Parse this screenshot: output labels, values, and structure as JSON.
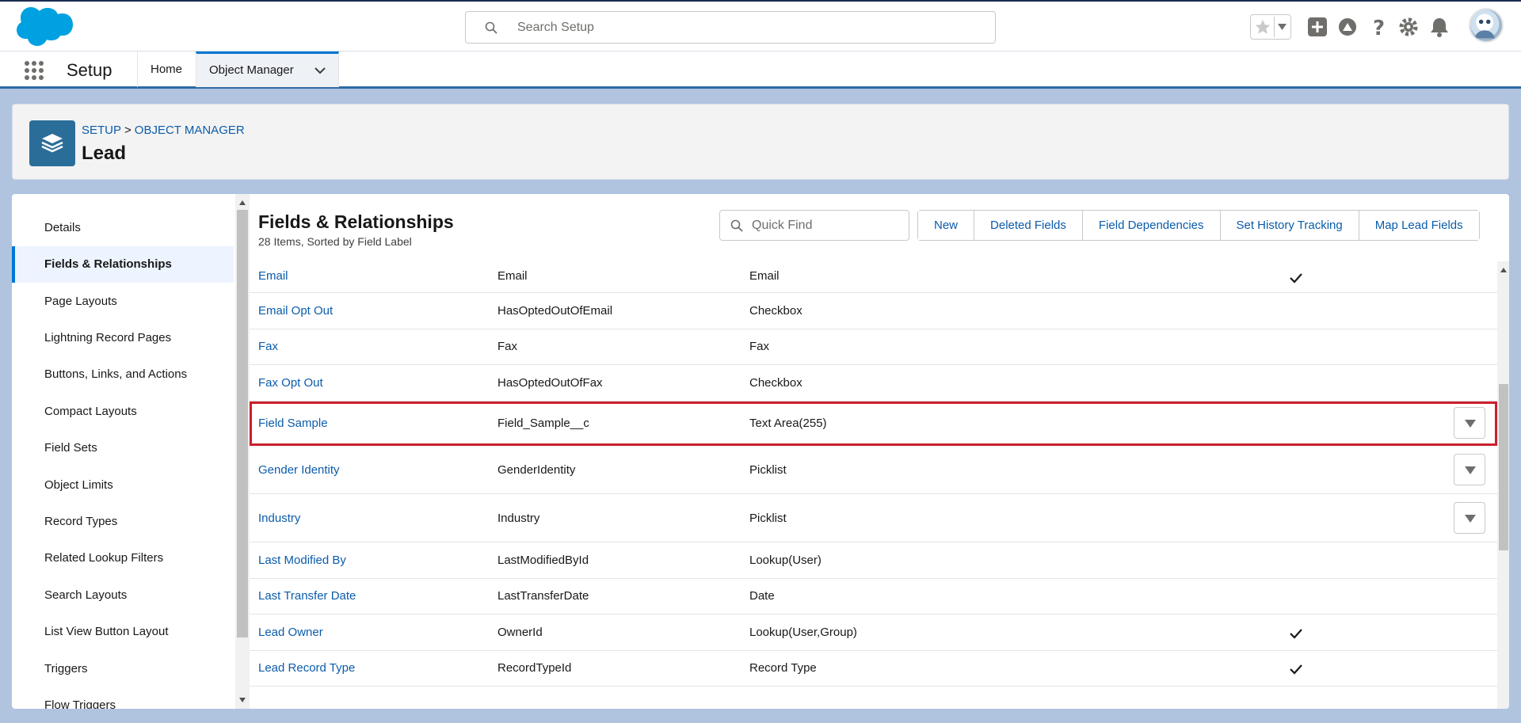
{
  "header": {
    "search_placeholder": "Search Setup",
    "icons": [
      "favorites-star-icon",
      "add-icon",
      "trailhead-icon",
      "help-icon",
      "gear-icon",
      "bell-icon",
      "avatar"
    ]
  },
  "nav": {
    "app_title": "Setup",
    "tabs": [
      {
        "label": "Home"
      },
      {
        "label": "Object Manager",
        "active": true
      }
    ]
  },
  "page_header": {
    "breadcrumb": [
      "SETUP",
      ">",
      "OBJECT MANAGER"
    ],
    "object_name": "Lead"
  },
  "sidebar": {
    "items": [
      {
        "label": "Details"
      },
      {
        "label": "Fields & Relationships",
        "active": true
      },
      {
        "label": "Page Layouts"
      },
      {
        "label": "Lightning Record Pages"
      },
      {
        "label": "Buttons, Links, and Actions"
      },
      {
        "label": "Compact Layouts"
      },
      {
        "label": "Field Sets"
      },
      {
        "label": "Object Limits"
      },
      {
        "label": "Record Types"
      },
      {
        "label": "Related Lookup Filters"
      },
      {
        "label": "Search Layouts"
      },
      {
        "label": "List View Button Layout"
      },
      {
        "label": "Triggers"
      },
      {
        "label": "Flow Triggers"
      }
    ]
  },
  "section": {
    "title": "Fields & Relationships",
    "subtitle": "28 Items, Sorted by Field Label",
    "quick_find_placeholder": "Quick Find",
    "buttons": [
      "New",
      "Deleted Fields",
      "Field Dependencies",
      "Set History Tracking",
      "Map Lead Fields"
    ]
  },
  "fields": [
    {
      "label": "Email",
      "api": "Email",
      "type": "Email",
      "indexed": true,
      "menu": false
    },
    {
      "label": "Email Opt Out",
      "api": "HasOptedOutOfEmail",
      "type": "Checkbox",
      "indexed": false,
      "menu": false
    },
    {
      "label": "Fax",
      "api": "Fax",
      "type": "Fax",
      "indexed": false,
      "menu": false
    },
    {
      "label": "Fax Opt Out",
      "api": "HasOptedOutOfFax",
      "type": "Checkbox",
      "indexed": false,
      "menu": false
    },
    {
      "label": "Field Sample",
      "api": "Field_Sample__c",
      "type": "Text Area(255)",
      "indexed": false,
      "menu": true,
      "highlighted": true
    },
    {
      "label": "Gender Identity",
      "api": "GenderIdentity",
      "type": "Picklist",
      "indexed": false,
      "menu": true
    },
    {
      "label": "Industry",
      "api": "Industry",
      "type": "Picklist",
      "indexed": false,
      "menu": true
    },
    {
      "label": "Last Modified By",
      "api": "LastModifiedById",
      "type": "Lookup(User)",
      "indexed": false,
      "menu": false
    },
    {
      "label": "Last Transfer Date",
      "api": "LastTransferDate",
      "type": "Date",
      "indexed": false,
      "menu": false
    },
    {
      "label": "Lead Owner",
      "api": "OwnerId",
      "type": "Lookup(User,Group)",
      "indexed": true,
      "menu": false
    },
    {
      "label": "Lead Record Type",
      "api": "RecordTypeId",
      "type": "Record Type",
      "indexed": true,
      "menu": false
    }
  ],
  "colors": {
    "link": "#0b5cab",
    "object_icon": "#2b6d99",
    "highlight_border": "#cc1f2d",
    "brand_blue": "#1b96ff"
  }
}
